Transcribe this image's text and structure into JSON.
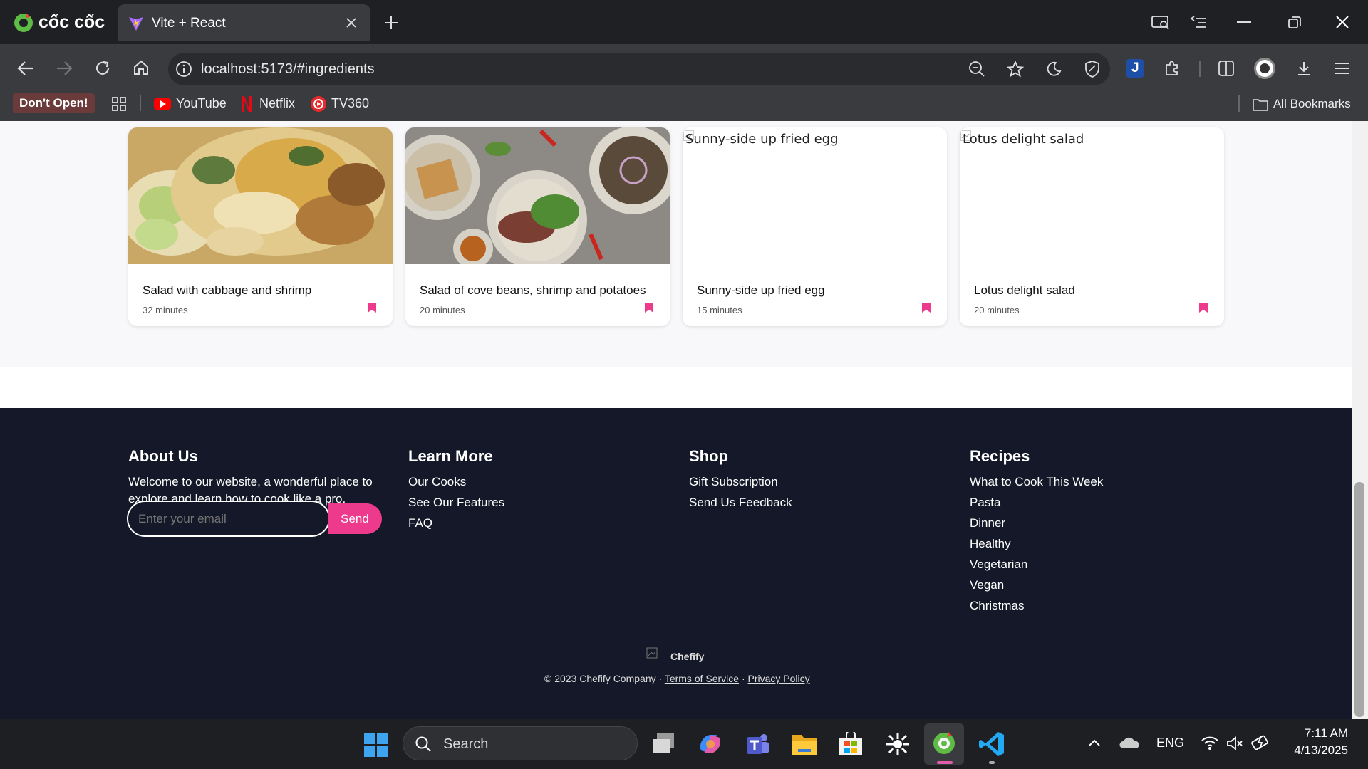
{
  "browser": {
    "brand": "cốc cốc",
    "tab_title": "Vite + React",
    "url": "localhost:5173/#ingredients",
    "bookmarks": [
      {
        "label": "Don't Open!"
      },
      {
        "label": "YouTube"
      },
      {
        "label": "Netflix"
      },
      {
        "label": "TV360"
      }
    ],
    "all_bookmarks": "All Bookmarks"
  },
  "recipes": [
    {
      "title": "Salad with cabbage and shrimp",
      "time": "32 minutes",
      "alt": ""
    },
    {
      "title": "Salad of cove beans, shrimp and potatoes",
      "time": "20 minutes",
      "alt": ""
    },
    {
      "title": "Sunny-side up fried egg",
      "time": "15 minutes",
      "alt": "Sunny-side up fried egg"
    },
    {
      "title": "Lotus delight salad",
      "time": "20 minutes",
      "alt": "Lotus delight salad"
    }
  ],
  "footer": {
    "about": {
      "heading": "About Us",
      "text_line1": "Welcome to our website, a wonderful place to",
      "text_line2": "explore and learn how to cook like a pro.",
      "email_placeholder": "Enter your email",
      "send_label": "Send"
    },
    "learn": {
      "heading": "Learn More",
      "links": [
        "Our Cooks",
        "See Our Features",
        "FAQ"
      ]
    },
    "shop": {
      "heading": "Shop",
      "links": [
        "Gift Subscription",
        "Send Us Feedback"
      ]
    },
    "recipes": {
      "heading": "Recipes",
      "links": [
        "What to Cook This Week",
        "Pasta",
        "Dinner",
        "Healthy",
        "Vegetarian",
        "Vegan",
        "Christmas"
      ]
    },
    "logo_text": "Chefify",
    "copyright": "© 2023 Chefify Company · ",
    "terms": "Terms of Service",
    "sep": " · ",
    "privacy": "Privacy Policy"
  },
  "taskbar": {
    "search_label": "Search",
    "lang": "ENG",
    "time": "7:11 AM",
    "date": "4/13/2025"
  },
  "colors": {
    "accent": "#ee3a8c",
    "footer_bg": "#141828",
    "chrome_bg": "#3a3b3f"
  }
}
